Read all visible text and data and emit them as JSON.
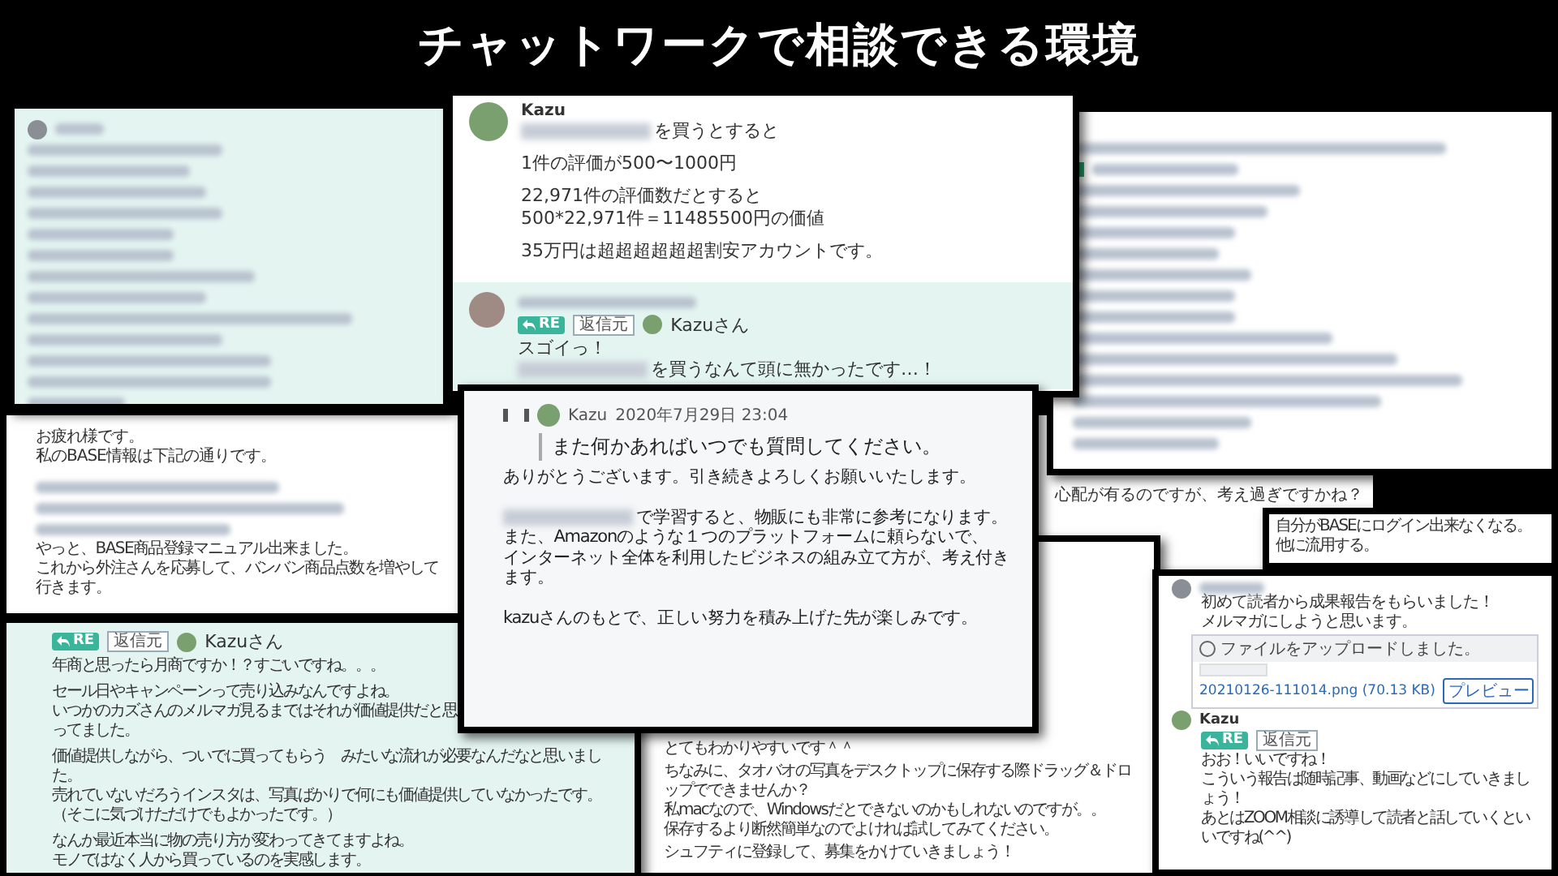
{
  "title": "チャットワークで相談できる環境",
  "back_panel": {
    "paragraphs": [
      [
        {
          "text": "お疲れ様です。",
          "redacted": false
        },
        {
          "text": "私のBASE情報は下記の通りです。",
          "redacted": false
        }
      ],
      [
        {
          "text": "やっと、BASE商品登録マニュアル出来ました。",
          "redacted": false
        },
        {
          "text": "これから外注さんを応募して、バンバン商品点数を増やして行きます。",
          "redacted": false
        }
      ]
    ],
    "side_note": "心配が有るのですが、考え過ぎですかね？"
  },
  "right_panel": {
    "paragraphs": [
      [
        {
          "text": "自分がBASEにログイン出来なくなる。",
          "redacted": false
        },
        {
          "text": "他に流用する。",
          "redacted": false
        }
      ]
    ]
  },
  "top_card": {
    "author": "Kazu",
    "paragraphs": [
      [
        {
          "text": "を買うとすると",
          "redacted": true
        }
      ],
      [
        {
          "text": "1件の評価が500〜1000円",
          "redacted": false
        }
      ],
      [
        {
          "text": "22,971件の評価数だとすると",
          "redacted": false
        },
        {
          "text": "500*22,971件＝11485500円の価値",
          "redacted": false
        }
      ],
      [
        {
          "text": "35万円は超超超超超超割安アカウントです。",
          "redacted": false
        }
      ]
    ],
    "reply": {
      "badge": "RE",
      "source": "返信元",
      "to": "Kazuさん",
      "paragraphs": [
        [
          {
            "text": "スゴイっ！",
            "redacted": false
          },
          {
            "text": "を買うなんて頭に無かったです…！",
            "redacted": true
          }
        ]
      ]
    }
  },
  "center_card": {
    "quote": {
      "author": "Kazu",
      "date": "2020年7月29日 23:04",
      "text": "また何かあればいつでも質問してください。"
    },
    "paragraphs": [
      [
        {
          "text": "ありがとうございます。引き続きよろしくお願いいたします。",
          "redacted": false
        }
      ],
      [
        {
          "text": "で学習すると、物販にも非常に参考になります。",
          "redacted": true
        },
        {
          "text": "また、Amazonのような１つのプラットフォームに頼らないで、",
          "redacted": false
        },
        {
          "text": "インターネット全体を利用したビジネスの組み立て方が、考え付きます。",
          "redacted": false
        }
      ],
      [
        {
          "text": "kazuさんのもとで、正しい努力を積み上げた先が楽しみです。",
          "redacted": false
        }
      ]
    ]
  },
  "bottom_left_card": {
    "reply": {
      "badge": "RE",
      "source": "返信元",
      "to": "Kazuさん"
    },
    "paragraphs": [
      [
        {
          "text": "年商と思ったら月商ですか！？すごいですね。。。",
          "redacted": false
        }
      ],
      [
        {
          "text": "セール日やキャンペーンって売り込みなんですよね。",
          "redacted": false
        },
        {
          "text": "いつかのカズさんのメルマガ見るまではそれが価値提供だと思ってました。",
          "redacted": false
        }
      ],
      [
        {
          "text": "価値提供しながら、ついでに買ってもらう　みたいな流れが必要なんだなと思いました。",
          "redacted": false
        },
        {
          "text": "売れていないだろうインスタは、写真ばかりで何にも価値提供していなかったです。",
          "redacted": false
        },
        {
          "text": "（そこに気づけただけでもよかったです。）",
          "redacted": false
        }
      ],
      [
        {
          "text": "なんか最近本当に物の売り方が変わってきてますよね。",
          "redacted": false
        },
        {
          "text": "モノではなく人から買っているのを実感します。",
          "redacted": false
        }
      ]
    ]
  },
  "bottom_card": {
    "paragraphs": [
      [
        {
          "text": "とてもわかりやすいです＾＾",
          "redacted": false
        }
      ],
      [
        {
          "text": "ちなみに、タオバオの写真をデスクトップに保存する際ドラッグ＆ドロップでできませんか？",
          "redacted": false
        },
        {
          "text": "私macなので、Windowsだとできないのかもしれないのですが。。",
          "redacted": false
        },
        {
          "text": "保存するより断然簡単なのでよければ試してみてください。",
          "redacted": false
        }
      ],
      [
        {
          "text": "シュフティに登録して、募集をかけていきましょう！",
          "redacted": false
        }
      ]
    ]
  },
  "bottom_right_card": {
    "paragraphs": [
      [
        {
          "text": "初めて読者から成果報告をもらいました！",
          "redacted": false
        },
        {
          "text": "メルマガにしようと思います。",
          "redacted": false
        }
      ]
    ],
    "file": {
      "notice": "ファイルをアップロードしました。",
      "name": "20210126-111014.png (70.13 KB)",
      "preview": "プレビュー"
    },
    "reply": {
      "author": "Kazu",
      "badge": "RE",
      "source": "返信元",
      "paragraphs": [
        [
          {
            "text": "おお！いいですね！",
            "redacted": false
          },
          {
            "text": "こういう報告は随時記事、動画などにしていきましょう！",
            "redacted": false
          },
          {
            "text": "あとはZOOM相談に誘導して読者と話していくといいですね(^^)",
            "redacted": false
          }
        ]
      ]
    }
  }
}
